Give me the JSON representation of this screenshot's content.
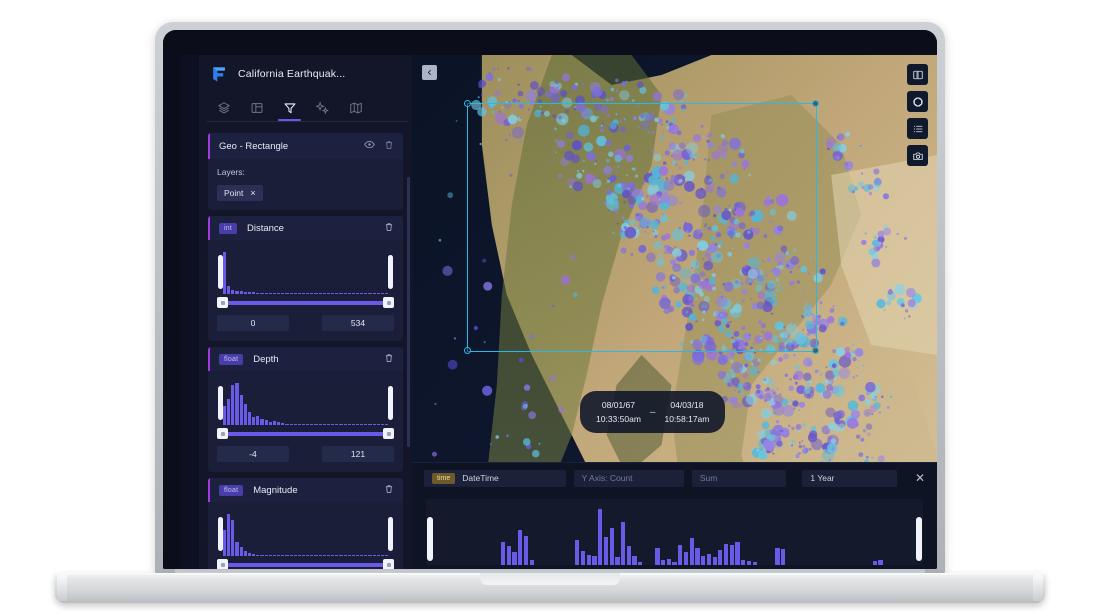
{
  "app": {
    "title": "California Earthquak...",
    "logo_icon": "foursquare-studio-logo"
  },
  "sidebar": {
    "tabs": [
      {
        "name": "layers",
        "icon": "layers-icon",
        "active": false
      },
      {
        "name": "filters-table",
        "icon": "panel-icon",
        "active": false
      },
      {
        "name": "filters",
        "icon": "funnel-icon",
        "active": true
      },
      {
        "name": "interactions",
        "icon": "sparkle-icon",
        "active": false
      },
      {
        "name": "basemap",
        "icon": "map-icon",
        "active": false
      }
    ],
    "geo_filter": {
      "title": "Geo - Rectangle",
      "eye_icon": "eye-icon",
      "trash_icon": "trash-icon",
      "layers_label": "Layers:",
      "layer_chip": "Point",
      "chip_close": "×"
    },
    "filters": [
      {
        "badge": "int",
        "badge_type": "int",
        "name": "Distance",
        "trash_icon": "trash-icon",
        "min": "0",
        "max": "534",
        "histogram": [
          100,
          18,
          9,
          7,
          6,
          5,
          4,
          4,
          3,
          3,
          3,
          2,
          2,
          2,
          2,
          2,
          1,
          1,
          1,
          1,
          1,
          1,
          1,
          1,
          1,
          1,
          1,
          1,
          1,
          1,
          1,
          1,
          1,
          1,
          1,
          1,
          1,
          1,
          1,
          1
        ]
      },
      {
        "badge": "float",
        "badge_type": "float",
        "name": "Depth",
        "trash_icon": "trash-icon",
        "min": "-4",
        "max": "121",
        "histogram": [
          46,
          62,
          96,
          100,
          72,
          50,
          30,
          20,
          22,
          14,
          11,
          8,
          9,
          6,
          4,
          3,
          2,
          2,
          1,
          1,
          1,
          1,
          1,
          1,
          1,
          1,
          1,
          1,
          1,
          1,
          1,
          1,
          1,
          1,
          1,
          1,
          1,
          1,
          1,
          1
        ]
      },
      {
        "badge": "float",
        "badge_type": "float",
        "name": "Magnitude",
        "trash_icon": "trash-icon",
        "min": "",
        "max": "",
        "histogram": [
          62,
          100,
          86,
          34,
          22,
          12,
          8,
          5,
          3,
          2,
          2,
          1,
          1,
          1,
          1,
          1,
          1,
          1,
          1,
          1,
          1,
          1,
          1,
          1,
          1,
          1,
          1,
          1,
          1,
          1,
          1,
          1,
          1,
          1,
          1,
          1,
          1,
          1,
          1,
          1
        ]
      }
    ]
  },
  "map": {
    "collapse_icon": "chevron-left-icon",
    "tools": [
      {
        "name": "split-view",
        "icon": "split-view-icon"
      },
      {
        "name": "3d-view",
        "icon": "cube-icon"
      },
      {
        "name": "legend",
        "icon": "list-icon"
      },
      {
        "name": "screenshot",
        "icon": "camera-icon"
      }
    ],
    "time_range": {
      "start_date": "08/01/67",
      "start_time": "10:33:50am",
      "separator": "–",
      "end_date": "04/03/18",
      "end_time": "10:58:17am"
    },
    "selection_color": "#28b9e8"
  },
  "time_panel": {
    "badge": "time",
    "field_datetime": "DateTime",
    "field_yaxis": "Y Axis: Count",
    "field_agg": "Sum",
    "interval": "1 Year",
    "close_label": "✕",
    "chart_data": {
      "type": "bar",
      "title": "",
      "xlabel": "",
      "ylabel": "Count",
      "values": [
        0,
        0,
        0,
        0,
        0,
        0,
        0,
        0,
        0,
        0,
        0,
        34,
        28,
        19,
        52,
        44,
        7,
        0,
        0,
        0,
        0,
        0,
        0,
        0,
        38,
        21,
        15,
        14,
        84,
        42,
        55,
        12,
        64,
        28,
        14,
        5,
        0,
        0,
        26,
        8,
        9,
        4,
        30,
        20,
        40,
        26,
        14,
        16,
        12,
        22,
        32,
        30,
        34,
        8,
        6,
        4,
        0,
        0,
        0,
        26,
        24,
        0,
        0,
        0,
        0,
        0,
        0,
        0,
        0,
        0,
        0,
        0,
        0,
        0,
        0,
        0,
        6,
        8,
        0,
        0,
        0,
        0,
        0
      ]
    }
  }
}
